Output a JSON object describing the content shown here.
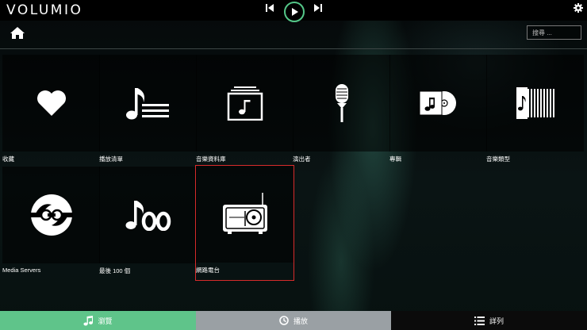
{
  "app": {
    "logo": "VOLUMIO"
  },
  "colors": {
    "accent": "#54c688",
    "selection": "#d72b2b",
    "tab_active": "#5fc48a",
    "tab_play": "#9aa0a4",
    "tab_queue": "#0b0b0b"
  },
  "header": {
    "icons": [
      "skip-previous-icon",
      "play-icon",
      "skip-next-icon",
      "gear-icon"
    ],
    "search_placeholder": "搜尋 ..."
  },
  "browse": {
    "home_icon": "home-icon",
    "tiles": [
      {
        "label": "收藏",
        "icon": "heart-icon"
      },
      {
        "label": "播放清單",
        "icon": "playlist-icon"
      },
      {
        "label": "音樂資料庫",
        "icon": "music-library-icon"
      },
      {
        "label": "演出者",
        "icon": "microphone-icon"
      },
      {
        "label": "專輯",
        "icon": "album-icon"
      },
      {
        "label": "音樂類型",
        "icon": "genre-icon"
      },
      {
        "label": "Media Servers",
        "icon": "media-servers-icon"
      },
      {
        "label": "最後 100 個",
        "icon": "last-100-icon"
      },
      {
        "label": "網路電台",
        "icon": "web-radio-icon",
        "selected": true
      }
    ]
  },
  "bottom_nav": {
    "browse": {
      "label": "瀏覽",
      "icon": "music-note-icon",
      "active": true
    },
    "playback": {
      "label": "播放",
      "icon": "clock-icon"
    },
    "queue": {
      "label": "詳列",
      "icon": "list-icon"
    }
  }
}
